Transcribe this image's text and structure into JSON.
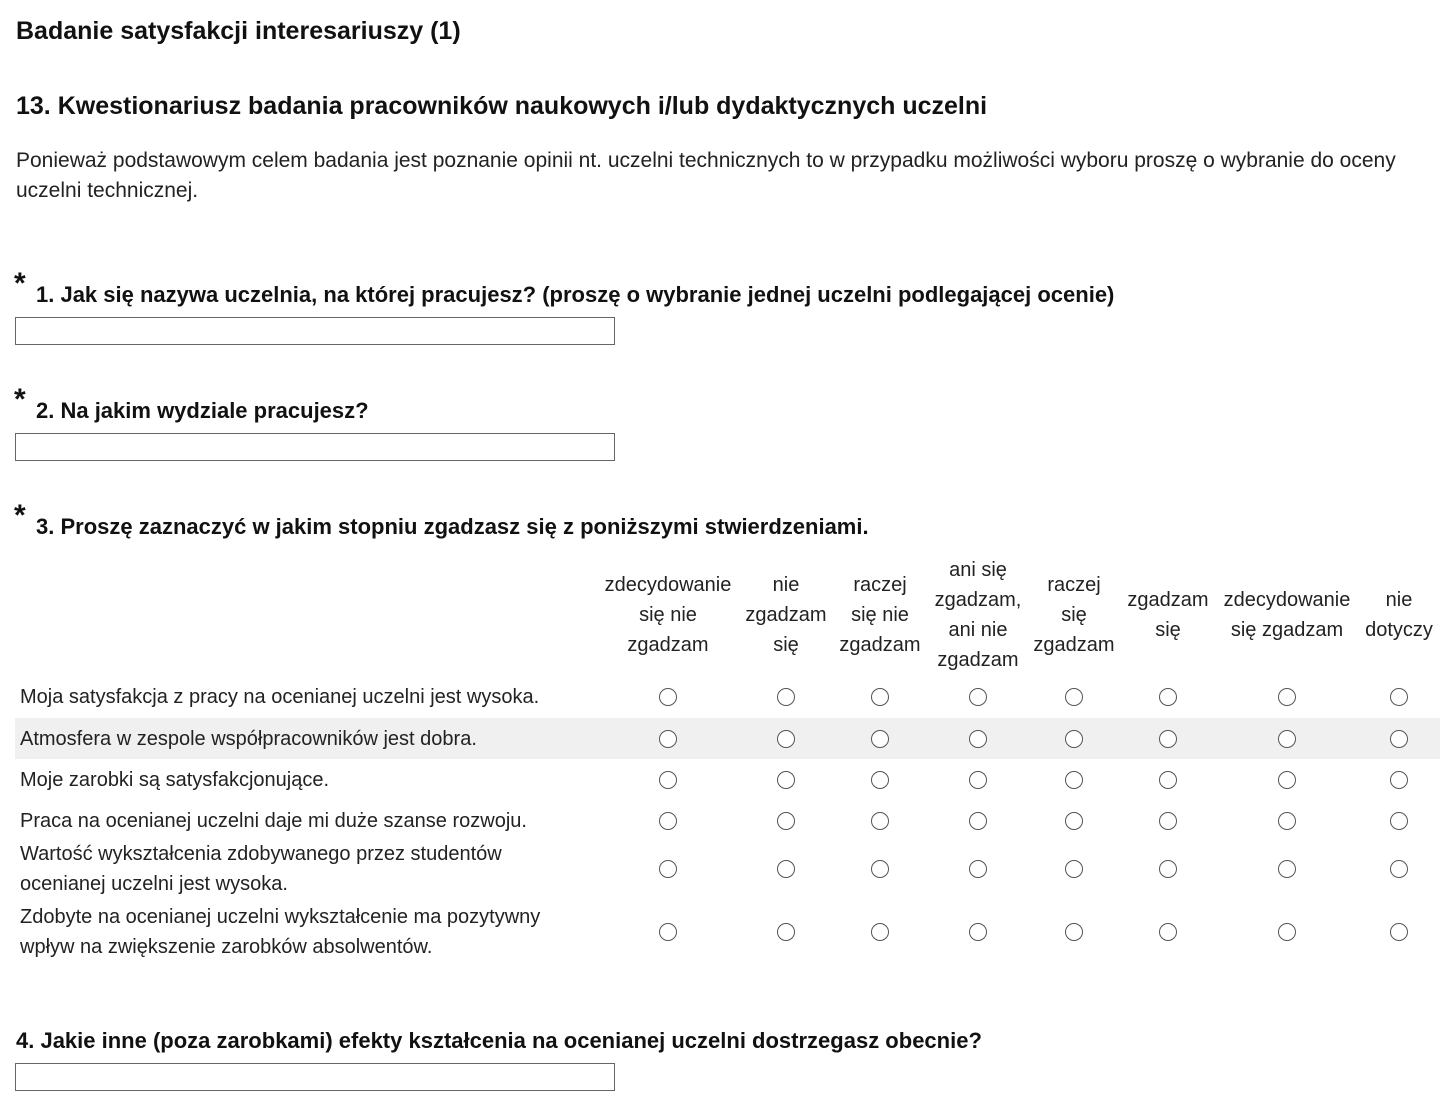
{
  "page_title": "Badanie satysfakcji interesariuszy (1)",
  "section_title": "13. Kwestionariusz badania pracowników naukowych i/lub dydaktycznych uczelni",
  "intro_text": "Ponieważ podstawowym celem badania jest poznanie opinii nt. uczelni technicznych to w przypadku możliwości wyboru proszę o wybranie do oceny uczelni technicznej.",
  "required_marker": "*",
  "questions": [
    {
      "label": "1. Jak się nazywa uczelnia, na której pracujesz? (proszę o wybranie jednej uczelni podlegającej ocenie)",
      "required": true,
      "value": ""
    },
    {
      "label": "2. Na jakim wydziale pracujesz?",
      "required": true,
      "value": ""
    },
    {
      "label": "3. Proszę zaznaczyć w jakim stopniu zgadzasz się z poniższymi stwierdzeniami.",
      "required": true
    },
    {
      "label": "4. Jakie inne (poza zarobkami) efekty kształcenia na ocenianej uczelni dostrzegasz obecnie?",
      "required": false,
      "value": ""
    }
  ],
  "matrix": {
    "columns": [
      {
        "lines": [
          "zdecydowanie",
          "się nie",
          "zgadzam"
        ]
      },
      {
        "lines": [
          "nie",
          "zgadzam",
          "się"
        ]
      },
      {
        "lines": [
          "raczej",
          "się nie",
          "zgadzam"
        ]
      },
      {
        "lines": [
          "ani się",
          "zgadzam,",
          "ani nie",
          "zgadzam"
        ]
      },
      {
        "lines": [
          "raczej",
          "się",
          "zgadzam"
        ]
      },
      {
        "lines": [
          "zgadzam",
          "się"
        ]
      },
      {
        "lines": [
          "zdecydowanie",
          "się zgadzam"
        ]
      },
      {
        "lines": [
          "nie",
          "dotyczy"
        ]
      }
    ],
    "rows": [
      {
        "lines": [
          "Moja satysfakcja z pracy na ocenianej uczelni jest wysoka."
        ]
      },
      {
        "lines": [
          "Atmosfera w zespole współpracowników jest dobra."
        ]
      },
      {
        "lines": [
          "Moje zarobki są satysfakcjonujące."
        ]
      },
      {
        "lines": [
          "Praca na ocenianej uczelni daje mi duże szanse rozwoju."
        ]
      },
      {
        "lines": [
          "Wartość wykształcenia zdobywanego przez studentów",
          "ocenianej uczelni jest wysoka."
        ]
      },
      {
        "lines": [
          "Zdobyte na ocenianej uczelni wykształcenie ma pozytywny",
          "wpływ na zwiększenie zarobków absolwentów."
        ]
      }
    ]
  }
}
